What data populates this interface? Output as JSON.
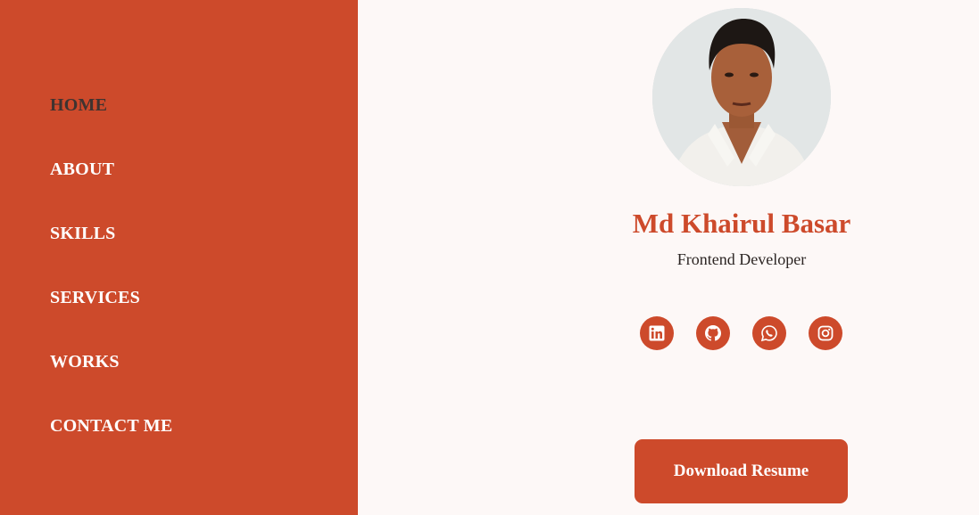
{
  "nav": {
    "items": [
      {
        "label": "HOME",
        "active": true
      },
      {
        "label": "ABOUT",
        "active": false
      },
      {
        "label": "SKILLS",
        "active": false
      },
      {
        "label": "SERVICES",
        "active": false
      },
      {
        "label": "WORKS",
        "active": false
      },
      {
        "label": "CONTACT ME",
        "active": false
      }
    ]
  },
  "profile": {
    "name": "Md Khairul Basar",
    "role": "Frontend Developer",
    "avatar_icon": "profile-photo"
  },
  "socials": [
    {
      "icon": "linkedin-icon"
    },
    {
      "icon": "github-icon"
    },
    {
      "icon": "whatsapp-icon"
    },
    {
      "icon": "instagram-icon"
    }
  ],
  "actions": {
    "resume_label": "Download Resume"
  },
  "colors": {
    "accent": "#cd4a2b",
    "background": "#fdf8f7",
    "active_nav_text": "#3f3330",
    "nav_text": "#ffffff"
  }
}
